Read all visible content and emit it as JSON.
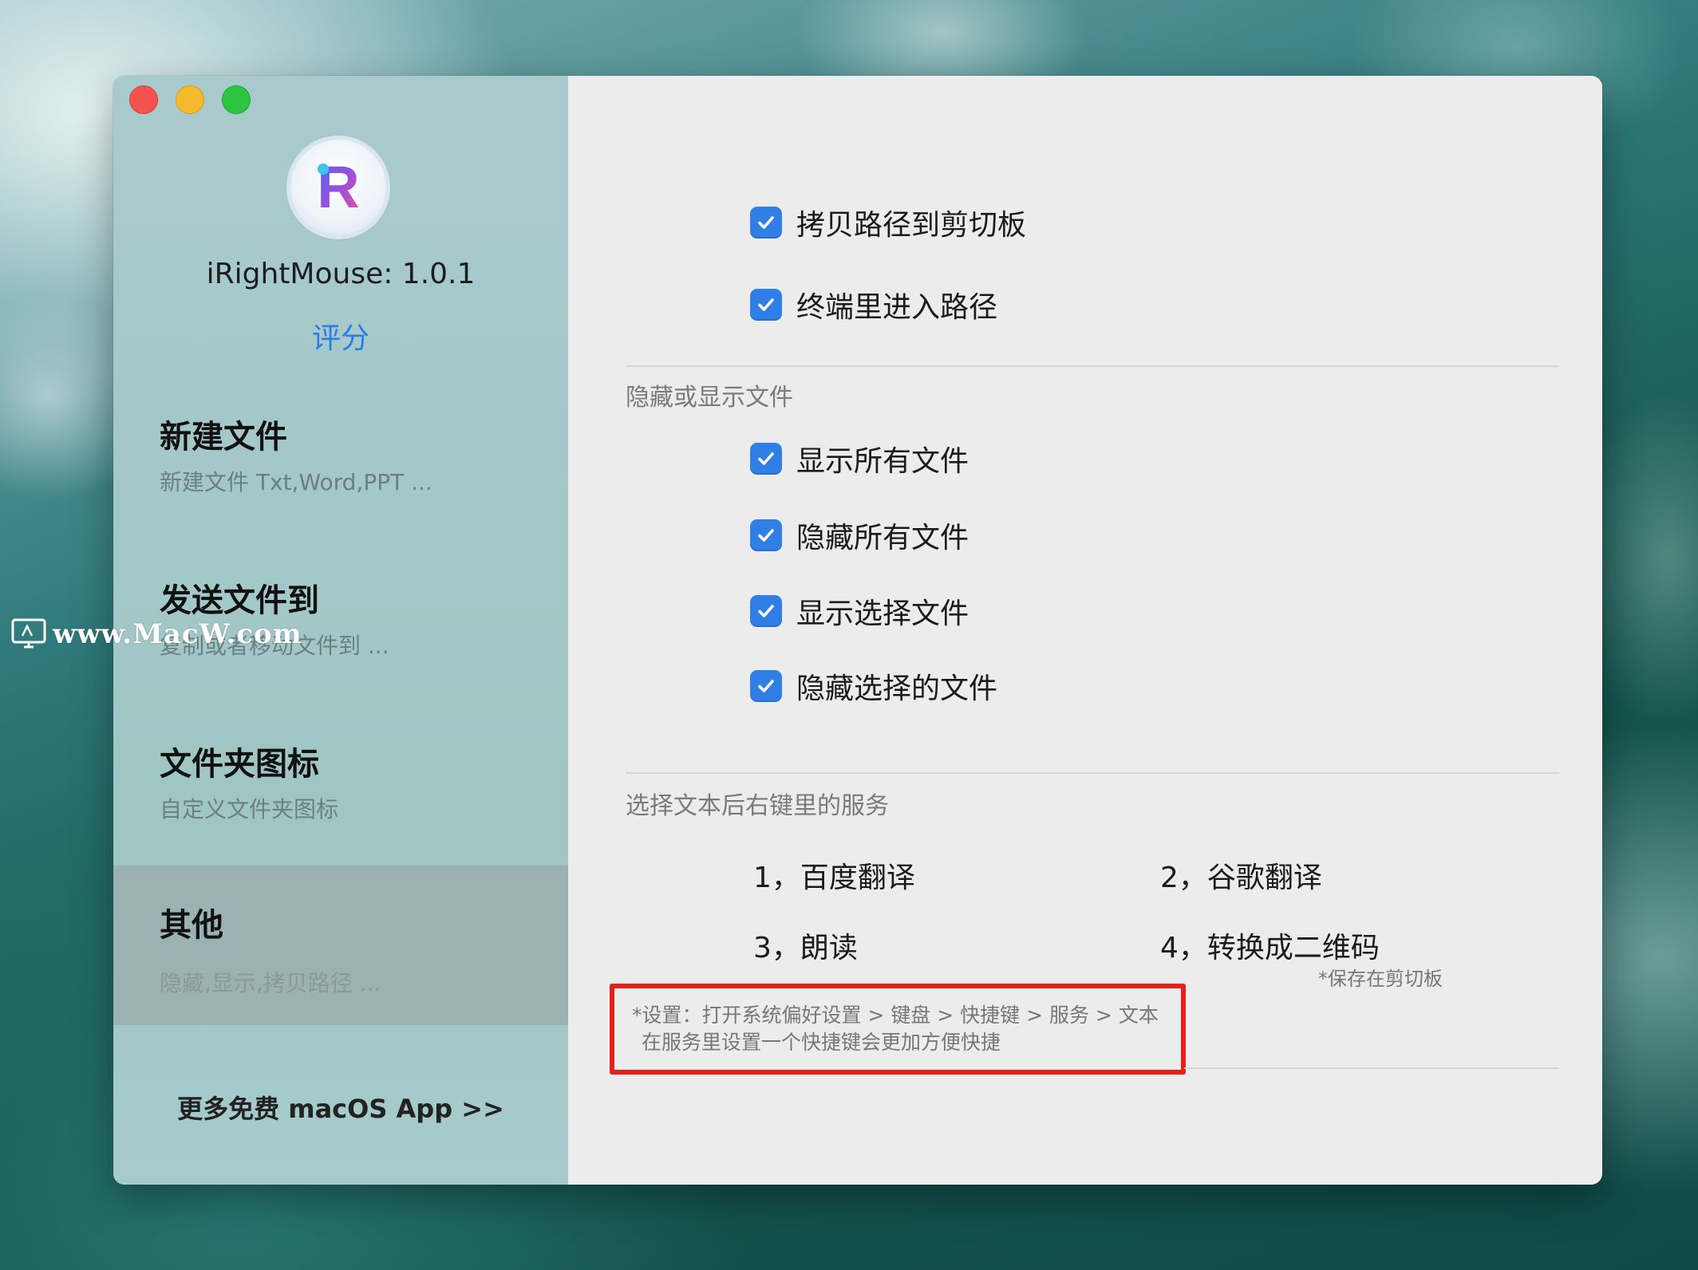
{
  "app": {
    "version_text": "iRightMouse: 1.0.1",
    "rate_label": "评分",
    "logo_letter": "R"
  },
  "sidebar": {
    "items": [
      {
        "title": "新建文件",
        "subtitle": "新建文件 Txt,Word,PPT ..."
      },
      {
        "title": "发送文件到",
        "subtitle": "复制或者移动文件到 ..."
      },
      {
        "title": "文件夹图标",
        "subtitle": "自定义文件夹图标"
      },
      {
        "title": "其他",
        "subtitle": "隐藏,显示,拷贝路径 ...",
        "selected": true
      }
    ],
    "more_apps": "更多免费 macOS App >>"
  },
  "content": {
    "path_options": [
      {
        "label": "拷贝路径到剪切板",
        "checked": true
      },
      {
        "label": "终端里进入路径",
        "checked": true
      }
    ],
    "hide_show_section": {
      "title": "隐藏或显示文件",
      "options": [
        {
          "label": "显示所有文件",
          "checked": true
        },
        {
          "label": "隐藏所有文件",
          "checked": true
        },
        {
          "label": "显示选择文件",
          "checked": true
        },
        {
          "label": "隐藏选择的文件",
          "checked": true
        }
      ]
    },
    "services_section": {
      "title": "选择文本后右键里的服务",
      "services": [
        "1，百度翻译",
        "2，谷歌翻译",
        "3，朗读",
        "4，转换成二维码"
      ],
      "qr_note": "*保存在剪切板",
      "setup_note_line1": "*设置：打开系统偏好设置 > 键盘 > 快捷键 > 服务 > 文本",
      "setup_note_line2": "在服务里设置一个快捷键会更加方便快捷"
    }
  },
  "watermark": "www.MacW.com",
  "colors": {
    "accent": "#2f7fe6",
    "highlight_box": "#e3211c",
    "link": "#2a7ee6"
  }
}
